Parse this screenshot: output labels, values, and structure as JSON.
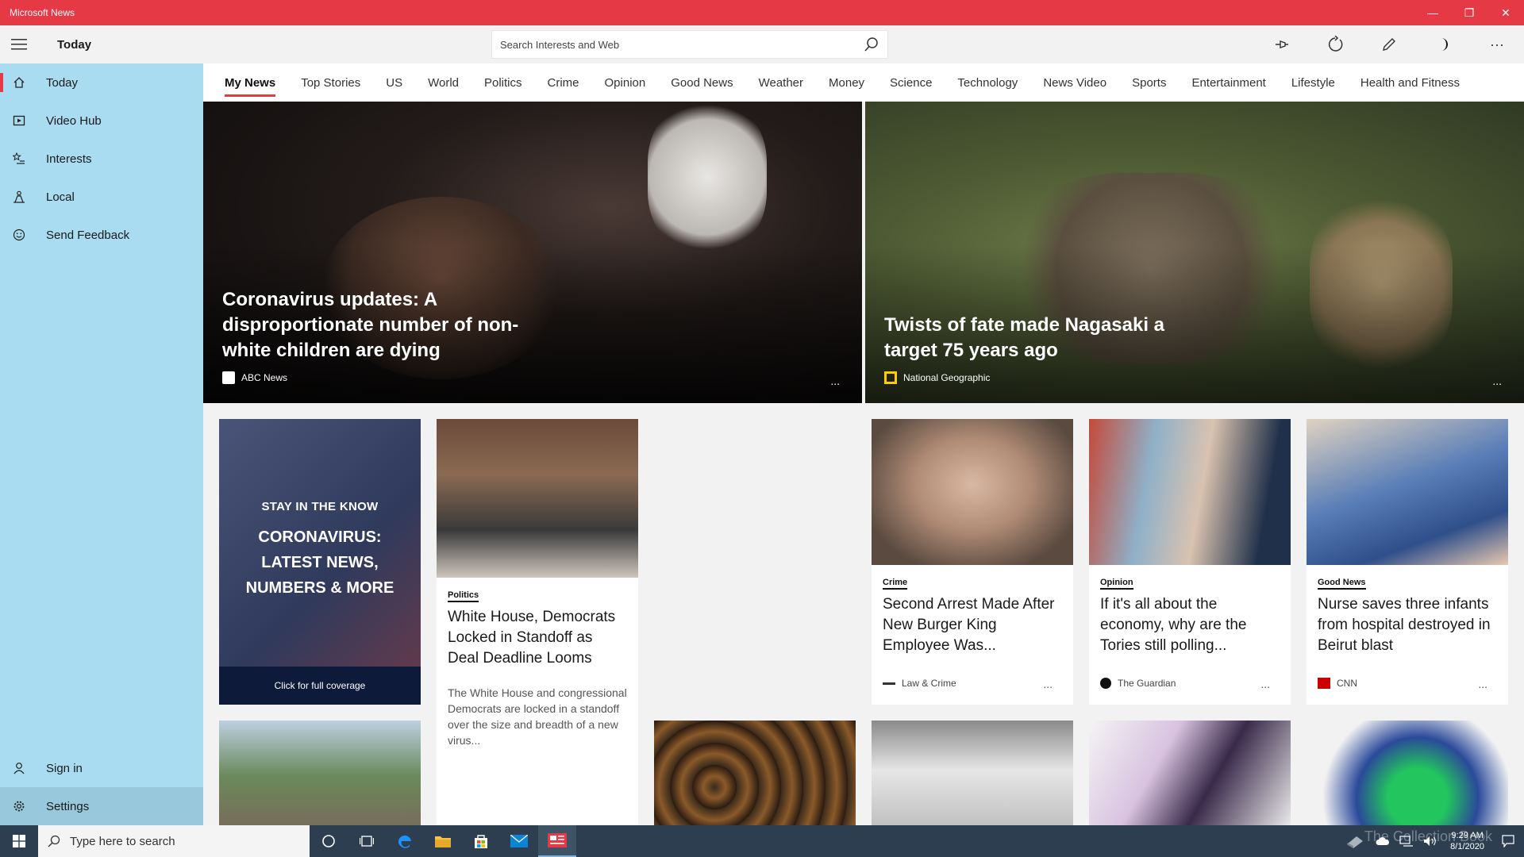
{
  "window": {
    "title": "Microsoft News"
  },
  "appbar": {
    "page_title": "Today",
    "search_placeholder": "Search Interests and Web"
  },
  "nav": {
    "items": [
      {
        "label": "Today",
        "icon": "home-icon"
      },
      {
        "label": "Video Hub",
        "icon": "video-icon"
      },
      {
        "label": "Interests",
        "icon": "star-list-icon"
      },
      {
        "label": "Local",
        "icon": "location-person-icon"
      },
      {
        "label": "Send Feedback",
        "icon": "smiley-icon"
      }
    ],
    "bottom": [
      {
        "label": "Sign in",
        "icon": "person-icon"
      },
      {
        "label": "Settings",
        "icon": "gear-icon"
      }
    ]
  },
  "tabs": [
    "My News",
    "Top Stories",
    "US",
    "World",
    "Politics",
    "Crime",
    "Opinion",
    "Good News",
    "Weather",
    "Money",
    "Science",
    "Technology",
    "News Video",
    "Sports",
    "Entertainment",
    "Lifestyle",
    "Health and Fitness"
  ],
  "heroes": [
    {
      "title": "Coronavirus updates: A disproportionate number of non-white children are dying",
      "source": "ABC News",
      "more": "..."
    },
    {
      "title": "Twists of fate made Nagasaki a target 75 years ago",
      "source": "National Geographic",
      "more": "..."
    }
  ],
  "promo": {
    "kicker": "STAY IN THE KNOW",
    "headline": "CORONAVIRUS: LATEST NEWS, NUMBERS & MORE",
    "cta": "Click for full coverage"
  },
  "politics_card": {
    "category": "Politics",
    "title": "White House, Democrats Locked in Standoff as Deal Deadline Looms",
    "description": "The White House and congressional Democrats are locked in a standoff over the size and breadth of a new virus..."
  },
  "cards": [
    {
      "category": "Crime",
      "title": "Second Arrest Made After New Burger King Employee Was...",
      "source": "Law & Crime",
      "more": "..."
    },
    {
      "category": "Opinion",
      "title": "If it's all about the economy, why are the Tories still polling...",
      "source": "The Guardian",
      "more": "..."
    },
    {
      "category": "Good News",
      "title": "Nurse saves three infants from hospital destroyed in Beirut blast",
      "source": "CNN",
      "more": "..."
    }
  ],
  "taskbar": {
    "search_placeholder": "Type here to search",
    "time": "9:29 AM",
    "date": "8/1/2020",
    "watermark": "The Collection Book"
  },
  "colors": {
    "accent": "#e63946",
    "sidebar": "#a9dcf0",
    "taskbar": "#2c3e50"
  }
}
